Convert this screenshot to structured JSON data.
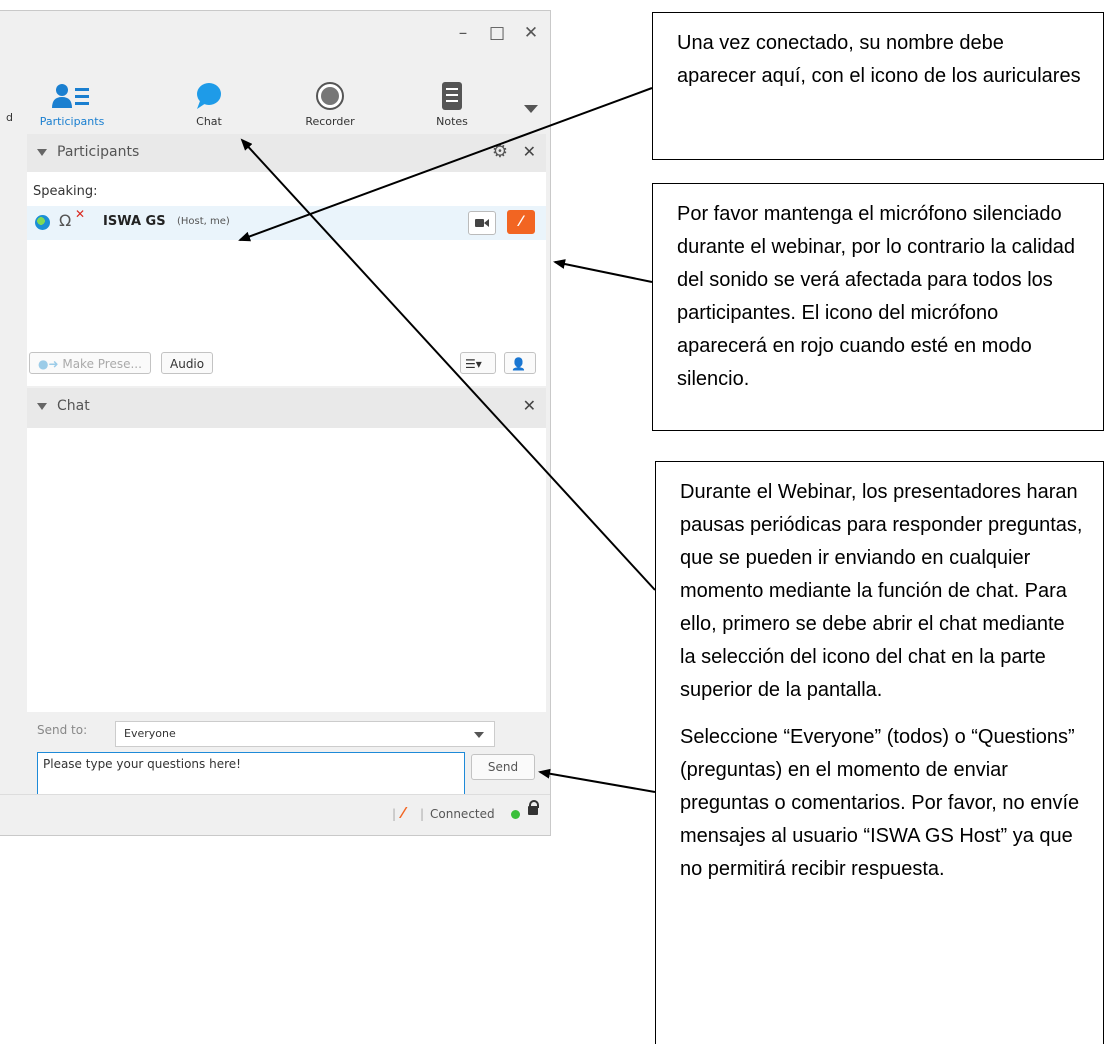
{
  "window": {
    "controls": [
      "–",
      "□",
      "✕"
    ],
    "edge_char": "d"
  },
  "toolbar": {
    "tools": [
      {
        "label": "Participants",
        "icon": "participants-icon",
        "active": true
      },
      {
        "label": "Chat",
        "icon": "chat-icon",
        "active": false
      },
      {
        "label": "Recorder",
        "icon": "recorder-icon",
        "active": false
      },
      {
        "label": "Notes",
        "icon": "notes-icon",
        "active": false
      }
    ]
  },
  "participants_panel": {
    "title": "Participants",
    "speaking_label": "Speaking:",
    "participant": {
      "name": "ISWA GS",
      "role": "(Host, me)"
    },
    "make_presenter_label": "Make Prese...",
    "audio_label": "Audio"
  },
  "chat_panel": {
    "title": "Chat",
    "send_to_label": "Send to:",
    "send_to_value": "Everyone",
    "input_value": "Please type your questions here!",
    "send_label": "Send"
  },
  "status": {
    "connected_label": "Connected"
  },
  "callouts": {
    "name_here": "Una vez conectado, su nombre debe aparecer aquí, con el icono de los auriculares",
    "mute_mic": "Por favor mantenga el micrófono silenciado durante el webinar, por lo contrario la calidad del sonido se verá afectada para todos los participantes. El icono del micrófono aparecerá en rojo cuando esté en modo silencio.",
    "webinar_questions": "Durante el Webinar, los presentadores haran pausas periódicas para responder preguntas, que se pueden ir enviando en cualquier momento mediante la función de chat. Para ello, primero se debe abrir el chat mediante la selección del icono del chat en la parte superior de la pantalla.",
    "select_recipient": "Seleccione “Everyone” (todos) o “Questions” (preguntas) en el momento de enviar preguntas o comentarios. Por favor, no envíe mensajes al usuario  “ISWA GS Host” ya que no permitirá recibir respuesta."
  },
  "colors": {
    "accent_blue": "#1a7fd0",
    "mute_orange": "#f26522",
    "connected_green": "#3bbf3b"
  }
}
